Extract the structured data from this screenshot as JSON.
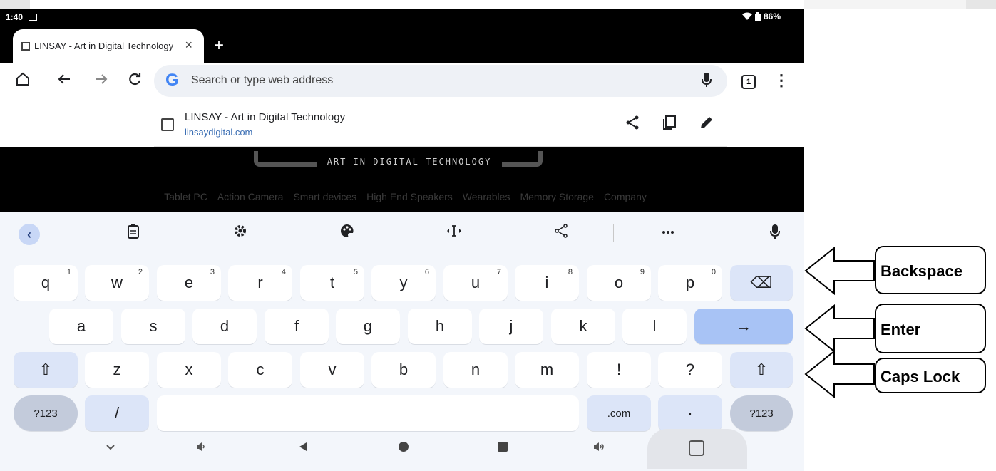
{
  "status_bar": {
    "time": "1:40",
    "battery": "86%"
  },
  "tab": {
    "title": "LINSAY - Art in Digital Technology",
    "close": "×",
    "new": "+"
  },
  "toolbar": {
    "omnibox_placeholder": "Search or type web address",
    "google_logo": "G",
    "tab_count": "1"
  },
  "suggestion": {
    "title": "LINSAY - Art in Digital Technology",
    "url": "linsaydigital.com"
  },
  "web": {
    "logo_text": "ART IN DIGITAL TECHNOLOGY",
    "nav": [
      "Tablet PC",
      "Action Camera",
      "Smart devices",
      "High End Speakers",
      "Wearables",
      "Memory Storage",
      "Company"
    ]
  },
  "keyboard": {
    "toolbar": [
      "clipboard-icon",
      "gear-icon",
      "palette-icon",
      "cursor-icon",
      "share-icon",
      "more-icon",
      "mic-icon"
    ],
    "row1": [
      {
        "k": "q",
        "h": "1"
      },
      {
        "k": "w",
        "h": "2"
      },
      {
        "k": "e",
        "h": "3"
      },
      {
        "k": "r",
        "h": "4"
      },
      {
        "k": "t",
        "h": "5"
      },
      {
        "k": "y",
        "h": "6"
      },
      {
        "k": "u",
        "h": "7"
      },
      {
        "k": "i",
        "h": "8"
      },
      {
        "k": "o",
        "h": "9"
      },
      {
        "k": "p",
        "h": "0"
      }
    ],
    "row2": [
      "a",
      "s",
      "d",
      "f",
      "g",
      "h",
      "j",
      "k",
      "l"
    ],
    "row3": [
      "z",
      "x",
      "c",
      "v",
      "b",
      "n",
      "m",
      "!",
      "?"
    ],
    "row4": {
      "sym_left": "?123",
      "slash": "/",
      "dotcom": ".com",
      "dot": "·",
      "sym_right": "?123"
    },
    "backspace": "⌫",
    "enter": "→",
    "shift": "⇧"
  },
  "annotations": {
    "backspace": "Backspace",
    "enter": "Enter",
    "caps": "Caps Lock"
  }
}
